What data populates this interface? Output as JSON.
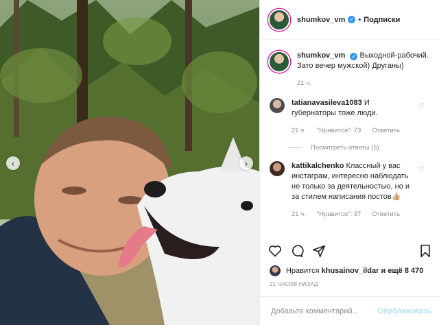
{
  "post": {
    "author": "shumkov_vm",
    "follow_label": "Подписки",
    "separator": "•",
    "verified_mark": "✓",
    "caption_text": "Выходной-рабочий. Зато вечер мужской) Друганы)",
    "caption_time": "21 ч."
  },
  "comments": [
    {
      "user": "tatianavasileva1083",
      "text": "И губернаторы тоже люди.",
      "time": "21 ч.",
      "likes": "\"Нравится\": 73",
      "reply_label": "Ответить",
      "view_replies": "Посмотреть ответы (5)"
    },
    {
      "user": "kattikalchenko",
      "text": "Классный у вас инстаграм, интересно наблюдать не только за деятельностью, но и за стилем написания постов👍🏼",
      "time": "21 ч.",
      "likes": "\"Нравится\": 37",
      "reply_label": "Ответить"
    }
  ],
  "likes_line": {
    "prefix": "Нравится",
    "user": "khusainov_ildar",
    "suffix": "и ещё 8 470"
  },
  "posted_time": "21 ЧАСОВ НАЗАД",
  "add_comment": {
    "placeholder": "Добавьте комментарий...",
    "publish_label": "Опубликовать"
  },
  "icons": {
    "nav_left": "‹",
    "nav_right": "›",
    "comment_heart": "♡"
  },
  "colors": {
    "verified": "#3897f0",
    "publish_disabled": "#b2dffc",
    "muted": "#8e8e8e"
  }
}
